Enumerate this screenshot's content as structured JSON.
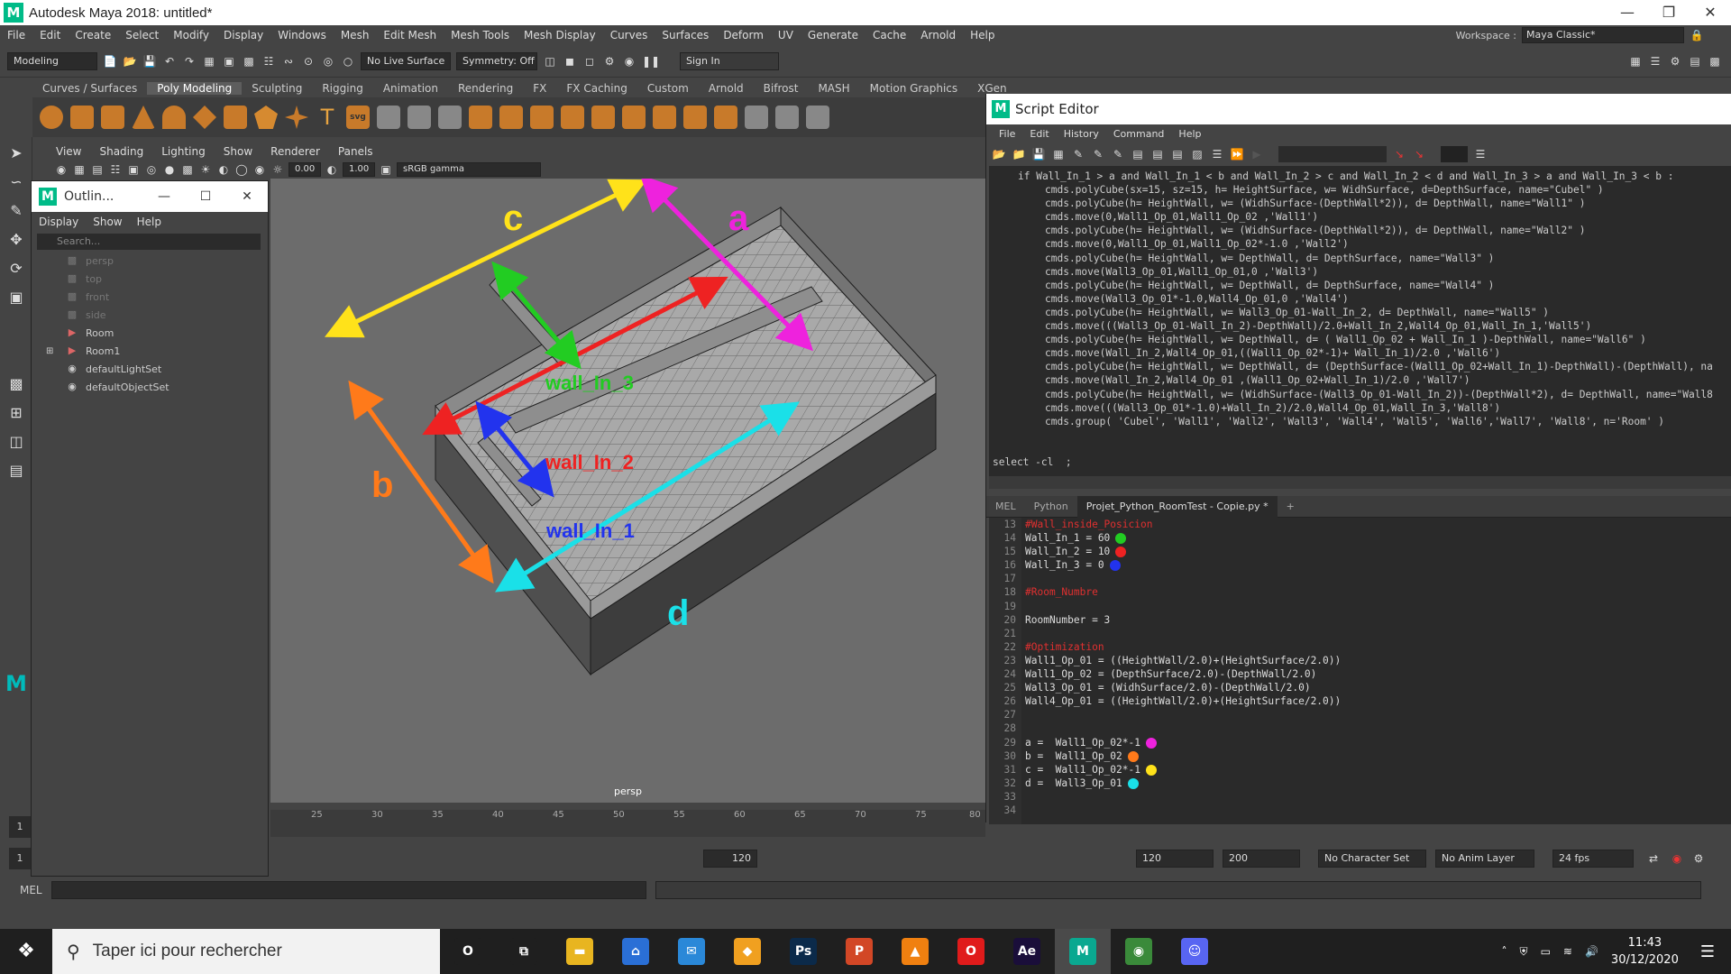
{
  "window": {
    "title": "Autodesk Maya 2018: untitled*",
    "logo": "M"
  },
  "menubar": [
    "File",
    "Edit",
    "Create",
    "Select",
    "Modify",
    "Display",
    "Windows",
    "Mesh",
    "Edit Mesh",
    "Mesh Tools",
    "Mesh Display",
    "Curves",
    "Surfaces",
    "Deform",
    "UV",
    "Generate",
    "Cache",
    "Arnold",
    "Help"
  ],
  "workspace": {
    "label": "Workspace :",
    "value": "Maya Classic*"
  },
  "statusline": {
    "mode": "Modeling",
    "live_surface": "No Live Surface",
    "symmetry": "Symmetry: Off",
    "sign_in": "Sign In"
  },
  "shelf_tabs": [
    "Curves / Surfaces",
    "Poly Modeling",
    "Sculpting",
    "Rigging",
    "Animation",
    "Rendering",
    "FX",
    "FX Caching",
    "Custom",
    "Arnold",
    "Bifrost",
    "MASH",
    "Motion Graphics",
    "XGen"
  ],
  "shelf_active": "Poly Modeling",
  "viewport": {
    "menu": [
      "View",
      "Shading",
      "Lighting",
      "Show",
      "Renderer",
      "Panels"
    ],
    "exposure": "0.00",
    "gamma": "1.00",
    "colorspace": "sRGB gamma",
    "camera_label": "persp",
    "annotations": {
      "a": "a",
      "b": "b",
      "c": "c",
      "d": "d",
      "wall1": "wall_In_1",
      "wall2": "wall_In_2",
      "wall3": "wall_In_3"
    }
  },
  "outliner": {
    "title": "Outlin...",
    "menu": [
      "Display",
      "Show",
      "Help"
    ],
    "search_placeholder": "Search...",
    "items": [
      "persp",
      "top",
      "front",
      "side",
      "Room",
      "Room1",
      "defaultLightSet",
      "defaultObjectSet"
    ]
  },
  "timeline": {
    "ticks": [
      "25",
      "30",
      "35",
      "40",
      "45",
      "50",
      "55",
      "60",
      "65",
      "70",
      "75",
      "80"
    ],
    "start": "1",
    "current": "1",
    "range_end": "120",
    "end_a": "120",
    "end_b": "200",
    "character_set": "No Character Set",
    "anim_layer": "No Anim Layer",
    "fps": "24 fps"
  },
  "cmdline": {
    "label": "MEL"
  },
  "script_editor": {
    "title": "Script Editor",
    "menu": [
      "File",
      "Edit",
      "History",
      "Command",
      "Help"
    ],
    "history": [
      "if Wall_In_1 > a and Wall_In_1 < b and Wall_In_2 > c and Wall_In_2 < d and Wall_In_3 > a and Wall_In_3 < b :",
      "cmds.polyCube(sx=15, sz=15, h= HeightSurface, w= WidhSurface, d=DepthSurface, name=\"Cubel\" )",
      "cmds.polyCube(h= HeightWall, w= (WidhSurface-(DepthWall*2)), d= DepthWall, name=\"Wall1\" )",
      "cmds.move(0,Wall1_Op_01,Wall1_Op_02 ,'Wall1')",
      "cmds.polyCube(h= HeightWall, w= (WidhSurface-(DepthWall*2)), d= DepthWall, name=\"Wall2\" )",
      "cmds.move(0,Wall1_Op_01,Wall1_Op_02*-1.0 ,'Wall2')",
      "cmds.polyCube(h= HeightWall, w= DepthWall, d= DepthSurface, name=\"Wall3\" )",
      "cmds.move(Wall3_Op_01,Wall1_Op_01,0 ,'Wall3')",
      "cmds.polyCube(h= HeightWall, w= DepthWall, d= DepthSurface, name=\"Wall4\" )",
      "cmds.move(Wall3_Op_01*-1.0,Wall4_Op_01,0 ,'Wall4')",
      "cmds.polyCube(h= HeightWall, w= Wall3_Op_01-Wall_In_2, d= DepthWall, name=\"Wall5\" )",
      "cmds.move(((Wall3_Op_01-Wall_In_2)-DepthWall)/2.0+Wall_In_2,Wall4_Op_01,Wall_In_1,'Wall5')",
      "cmds.polyCube(h= HeightWall, w= DepthWall, d= ( Wall1_Op_02 + Wall_In_1 )-DepthWall, name=\"Wall6\" )",
      "cmds.move(Wall_In_2,Wall4_Op_01,((Wall1_Op_02*-1)+ Wall_In_1)/2.0 ,'Wall6')",
      "cmds.polyCube(h= HeightWall, w= DepthWall, d= (DepthSurface-(Wall1_Op_02+Wall_In_1)-DepthWall)-(DepthWall), na",
      "cmds.move(Wall_In_2,Wall4_Op_01 ,(Wall1_Op_02+Wall_In_1)/2.0 ,'Wall7')",
      "cmds.polyCube(h= HeightWall, w= (WidhSurface-(Wall3_Op_01-Wall_In_2))-(DepthWall*2), d= DepthWall, name=\"Wall8",
      "cmds.move(((Wall3_Op_01*-1.0)+Wall_In_2)/2.0,Wall4_Op_01,Wall_In_3,'Wall8')",
      "cmds.group( 'Cubel', 'Wall1', 'Wall2', 'Wall3', 'Wall4', 'Wall5', 'Wall6','Wall7', 'Wall8', n='Room' )"
    ],
    "history_last": "select -cl  ;",
    "tabs": [
      "MEL",
      "Python",
      "Projet_Python_RoomTest - Copie.py *",
      "+"
    ],
    "active_tab": "Projet_Python_RoomTest - Copie.py *",
    "code": [
      {
        "n": "13",
        "text": "#Wall_inside_Posicion",
        "comment": true
      },
      {
        "n": "14",
        "text": "Wall_In_1 = 60",
        "dot": "#22cc22"
      },
      {
        "n": "15",
        "text": "Wall_In_2 = 10",
        "dot": "#ee2222"
      },
      {
        "n": "16",
        "text": "Wall_In_3 = 0",
        "dot": "#2233ee"
      },
      {
        "n": "17",
        "text": ""
      },
      {
        "n": "18",
        "text": "#Room_Numbre",
        "comment": true
      },
      {
        "n": "19",
        "text": ""
      },
      {
        "n": "20",
        "text": "RoomNumber = 3"
      },
      {
        "n": "21",
        "text": ""
      },
      {
        "n": "22",
        "text": "#Optimization",
        "comment": true
      },
      {
        "n": "23",
        "text": "Wall1_Op_01 = ((HeightWall/2.0)+(HeightSurface/2.0))"
      },
      {
        "n": "24",
        "text": "Wall1_Op_02 = (DepthSurface/2.0)-(DepthWall/2.0)"
      },
      {
        "n": "25",
        "text": "Wall3_Op_01 = (WidhSurface/2.0)-(DepthWall/2.0)"
      },
      {
        "n": "26",
        "text": "Wall4_Op_01 = ((HeightWall/2.0)+(HeightSurface/2.0))"
      },
      {
        "n": "27",
        "text": ""
      },
      {
        "n": "28",
        "text": ""
      },
      {
        "n": "29",
        "text": "a =  Wall1_Op_02*-1",
        "dot": "#ee22dd"
      },
      {
        "n": "30",
        "text": "b =  Wall1_Op_02",
        "dot": "#ff7a1a"
      },
      {
        "n": "31",
        "text": "c =  Wall1_Op_02*-1",
        "dot": "#ffe21a"
      },
      {
        "n": "32",
        "text": "d =  Wall3_Op_01",
        "dot": "#1ae0e8"
      },
      {
        "n": "33",
        "text": ""
      },
      {
        "n": "34",
        "text": ""
      }
    ]
  },
  "taskbar": {
    "search_placeholder": "Taper ici pour rechercher",
    "apps": [
      {
        "name": "cortana",
        "label": "O",
        "color": "#1f1f1f"
      },
      {
        "name": "task-view",
        "label": "⧉",
        "color": "#1f1f1f"
      },
      {
        "name": "file-explorer",
        "label": "▬",
        "color": "#e8b520"
      },
      {
        "name": "store",
        "label": "⌂",
        "color": "#2a6fd6"
      },
      {
        "name": "mail",
        "label": "✉",
        "color": "#2a88d8"
      },
      {
        "name": "brave",
        "label": "◆",
        "color": "#f0a020"
      },
      {
        "name": "photoshop",
        "label": "Ps",
        "color": "#0b2a4a"
      },
      {
        "name": "powerpoint",
        "label": "P",
        "color": "#d24726"
      },
      {
        "name": "vlc",
        "label": "▲",
        "color": "#f08010"
      },
      {
        "name": "opera",
        "label": "O",
        "color": "#e01b1b"
      },
      {
        "name": "after-effects",
        "label": "Ae",
        "color": "#1a0e3a"
      },
      {
        "name": "maya",
        "label": "M",
        "color": "#0aa890"
      },
      {
        "name": "chrome",
        "label": "◉",
        "color": "#3a8a3a"
      },
      {
        "name": "discord",
        "label": "☺",
        "color": "#5865f2"
      }
    ],
    "active_app": "maya",
    "time": "11:43",
    "date": "30/12/2020"
  }
}
